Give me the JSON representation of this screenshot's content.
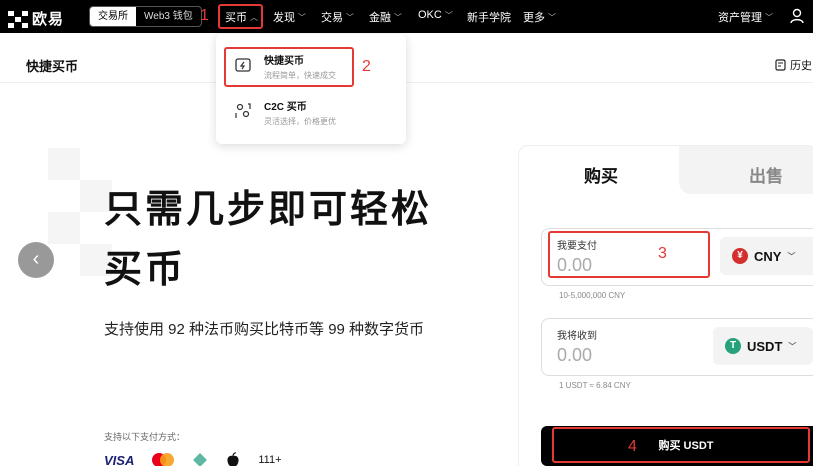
{
  "nav": {
    "logo_text": "欧易",
    "segment": [
      "交易所",
      "Web3 钱包"
    ],
    "items": [
      {
        "label": "买币",
        "id": "buy"
      },
      {
        "label": "发现",
        "id": "discover"
      },
      {
        "label": "交易",
        "id": "trade"
      },
      {
        "label": "金融",
        "id": "finance"
      },
      {
        "label": "OKC",
        "id": "okc"
      },
      {
        "label": "新手学院",
        "id": "academy"
      },
      {
        "label": "更多",
        "id": "more"
      }
    ],
    "assets": "资产管理"
  },
  "subheader": {
    "title": "快捷买币",
    "history": "历史"
  },
  "dropdown": {
    "items": [
      {
        "title": "快捷买币",
        "desc": "流程简单，快速成交"
      },
      {
        "title": "C2C 买币",
        "desc": "灵活选择，价格更优"
      }
    ]
  },
  "hero": {
    "title_line1": "只需几步即可轻松",
    "title_line2": "买币",
    "subtitle": "支持使用 92 种法币购买比特币等 99 种数字货币",
    "payment_label": "支持以下支付方式：",
    "payment_more": "111+",
    "visa": "VISA"
  },
  "card": {
    "tab_buy": "购买",
    "tab_sell": "出售",
    "pay": {
      "label": "我要支付",
      "value": "0.00",
      "currency": "CNY",
      "currency_symbol": "¥",
      "hint": "10-5,000,000 CNY"
    },
    "receive": {
      "label": "我将收到",
      "value": "0.00",
      "currency": "USDT",
      "currency_symbol": "T",
      "hint": "1 USDT ≈ 6.84 CNY"
    },
    "buy_button": "购买 USDT"
  },
  "annotations": [
    "1",
    "2",
    "3",
    "4"
  ],
  "colors": {
    "accent": "#000000",
    "annotation": "#e53935",
    "cny": "#d32f2f",
    "usdt": "#26a17b"
  }
}
